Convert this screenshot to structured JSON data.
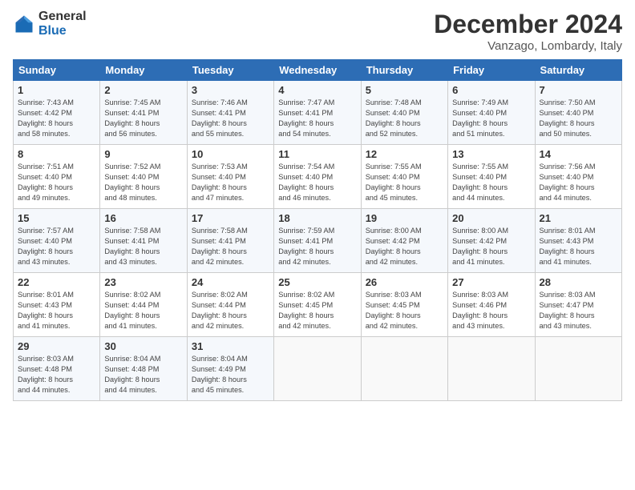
{
  "logo": {
    "general": "General",
    "blue": "Blue"
  },
  "header": {
    "month": "December 2024",
    "location": "Vanzago, Lombardy, Italy"
  },
  "weekdays": [
    "Sunday",
    "Monday",
    "Tuesday",
    "Wednesday",
    "Thursday",
    "Friday",
    "Saturday"
  ],
  "weeks": [
    [
      {
        "day": "1",
        "lines": [
          "Sunrise: 7:43 AM",
          "Sunset: 4:42 PM",
          "Daylight: 8 hours",
          "and 58 minutes."
        ]
      },
      {
        "day": "2",
        "lines": [
          "Sunrise: 7:45 AM",
          "Sunset: 4:41 PM",
          "Daylight: 8 hours",
          "and 56 minutes."
        ]
      },
      {
        "day": "3",
        "lines": [
          "Sunrise: 7:46 AM",
          "Sunset: 4:41 PM",
          "Daylight: 8 hours",
          "and 55 minutes."
        ]
      },
      {
        "day": "4",
        "lines": [
          "Sunrise: 7:47 AM",
          "Sunset: 4:41 PM",
          "Daylight: 8 hours",
          "and 54 minutes."
        ]
      },
      {
        "day": "5",
        "lines": [
          "Sunrise: 7:48 AM",
          "Sunset: 4:40 PM",
          "Daylight: 8 hours",
          "and 52 minutes."
        ]
      },
      {
        "day": "6",
        "lines": [
          "Sunrise: 7:49 AM",
          "Sunset: 4:40 PM",
          "Daylight: 8 hours",
          "and 51 minutes."
        ]
      },
      {
        "day": "7",
        "lines": [
          "Sunrise: 7:50 AM",
          "Sunset: 4:40 PM",
          "Daylight: 8 hours",
          "and 50 minutes."
        ]
      }
    ],
    [
      {
        "day": "8",
        "lines": [
          "Sunrise: 7:51 AM",
          "Sunset: 4:40 PM",
          "Daylight: 8 hours",
          "and 49 minutes."
        ]
      },
      {
        "day": "9",
        "lines": [
          "Sunrise: 7:52 AM",
          "Sunset: 4:40 PM",
          "Daylight: 8 hours",
          "and 48 minutes."
        ]
      },
      {
        "day": "10",
        "lines": [
          "Sunrise: 7:53 AM",
          "Sunset: 4:40 PM",
          "Daylight: 8 hours",
          "and 47 minutes."
        ]
      },
      {
        "day": "11",
        "lines": [
          "Sunrise: 7:54 AM",
          "Sunset: 4:40 PM",
          "Daylight: 8 hours",
          "and 46 minutes."
        ]
      },
      {
        "day": "12",
        "lines": [
          "Sunrise: 7:55 AM",
          "Sunset: 4:40 PM",
          "Daylight: 8 hours",
          "and 45 minutes."
        ]
      },
      {
        "day": "13",
        "lines": [
          "Sunrise: 7:55 AM",
          "Sunset: 4:40 PM",
          "Daylight: 8 hours",
          "and 44 minutes."
        ]
      },
      {
        "day": "14",
        "lines": [
          "Sunrise: 7:56 AM",
          "Sunset: 4:40 PM",
          "Daylight: 8 hours",
          "and 44 minutes."
        ]
      }
    ],
    [
      {
        "day": "15",
        "lines": [
          "Sunrise: 7:57 AM",
          "Sunset: 4:40 PM",
          "Daylight: 8 hours",
          "and 43 minutes."
        ]
      },
      {
        "day": "16",
        "lines": [
          "Sunrise: 7:58 AM",
          "Sunset: 4:41 PM",
          "Daylight: 8 hours",
          "and 43 minutes."
        ]
      },
      {
        "day": "17",
        "lines": [
          "Sunrise: 7:58 AM",
          "Sunset: 4:41 PM",
          "Daylight: 8 hours",
          "and 42 minutes."
        ]
      },
      {
        "day": "18",
        "lines": [
          "Sunrise: 7:59 AM",
          "Sunset: 4:41 PM",
          "Daylight: 8 hours",
          "and 42 minutes."
        ]
      },
      {
        "day": "19",
        "lines": [
          "Sunrise: 8:00 AM",
          "Sunset: 4:42 PM",
          "Daylight: 8 hours",
          "and 42 minutes."
        ]
      },
      {
        "day": "20",
        "lines": [
          "Sunrise: 8:00 AM",
          "Sunset: 4:42 PM",
          "Daylight: 8 hours",
          "and 41 minutes."
        ]
      },
      {
        "day": "21",
        "lines": [
          "Sunrise: 8:01 AM",
          "Sunset: 4:43 PM",
          "Daylight: 8 hours",
          "and 41 minutes."
        ]
      }
    ],
    [
      {
        "day": "22",
        "lines": [
          "Sunrise: 8:01 AM",
          "Sunset: 4:43 PM",
          "Daylight: 8 hours",
          "and 41 minutes."
        ]
      },
      {
        "day": "23",
        "lines": [
          "Sunrise: 8:02 AM",
          "Sunset: 4:44 PM",
          "Daylight: 8 hours",
          "and 41 minutes."
        ]
      },
      {
        "day": "24",
        "lines": [
          "Sunrise: 8:02 AM",
          "Sunset: 4:44 PM",
          "Daylight: 8 hours",
          "and 42 minutes."
        ]
      },
      {
        "day": "25",
        "lines": [
          "Sunrise: 8:02 AM",
          "Sunset: 4:45 PM",
          "Daylight: 8 hours",
          "and 42 minutes."
        ]
      },
      {
        "day": "26",
        "lines": [
          "Sunrise: 8:03 AM",
          "Sunset: 4:45 PM",
          "Daylight: 8 hours",
          "and 42 minutes."
        ]
      },
      {
        "day": "27",
        "lines": [
          "Sunrise: 8:03 AM",
          "Sunset: 4:46 PM",
          "Daylight: 8 hours",
          "and 43 minutes."
        ]
      },
      {
        "day": "28",
        "lines": [
          "Sunrise: 8:03 AM",
          "Sunset: 4:47 PM",
          "Daylight: 8 hours",
          "and 43 minutes."
        ]
      }
    ],
    [
      {
        "day": "29",
        "lines": [
          "Sunrise: 8:03 AM",
          "Sunset: 4:48 PM",
          "Daylight: 8 hours",
          "and 44 minutes."
        ]
      },
      {
        "day": "30",
        "lines": [
          "Sunrise: 8:04 AM",
          "Sunset: 4:48 PM",
          "Daylight: 8 hours",
          "and 44 minutes."
        ]
      },
      {
        "day": "31",
        "lines": [
          "Sunrise: 8:04 AM",
          "Sunset: 4:49 PM",
          "Daylight: 8 hours",
          "and 45 minutes."
        ]
      },
      null,
      null,
      null,
      null
    ]
  ]
}
